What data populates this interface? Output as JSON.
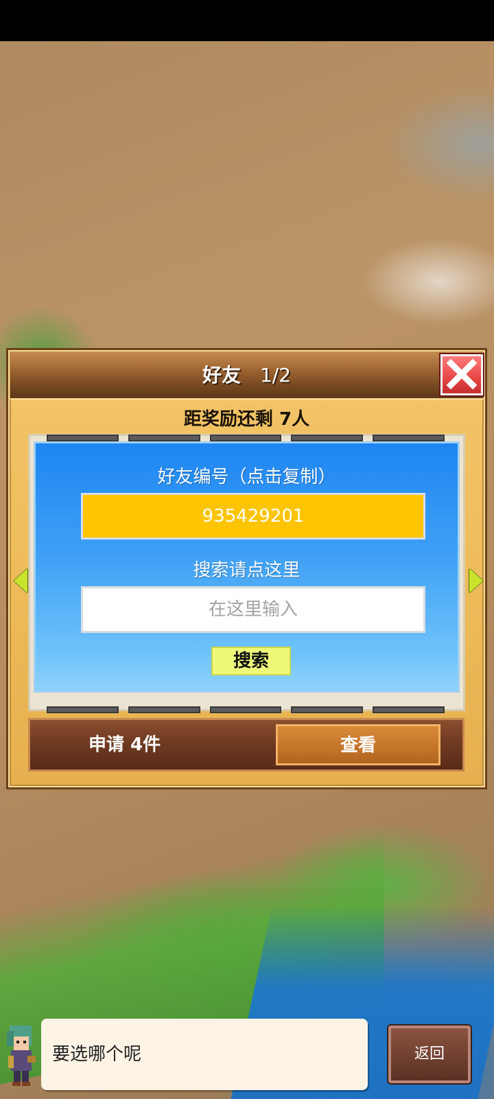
{
  "dialog": {
    "title": "好友",
    "page_indicator": "1/2",
    "reward_text": "距奖励还剩 7人"
  },
  "friend_code": {
    "label": "好友编号（点击复制）",
    "value": "935429201"
  },
  "search": {
    "label": "搜索请点这里",
    "placeholder": "在这里输入",
    "button_label": "搜索"
  },
  "requests": {
    "text": "申请 4件",
    "view_label": "查看"
  },
  "speech": {
    "text": "要选哪个呢"
  },
  "back_button": {
    "label": "返回"
  },
  "colors": {
    "panel_blue": "#1e86f2",
    "friend_id_yellow": "#ffc400",
    "search_button": "#eef97a",
    "close_red": "#e64545"
  },
  "icons": [
    "close-icon",
    "arrow-left-icon",
    "arrow-right-icon",
    "character-avatar"
  ]
}
